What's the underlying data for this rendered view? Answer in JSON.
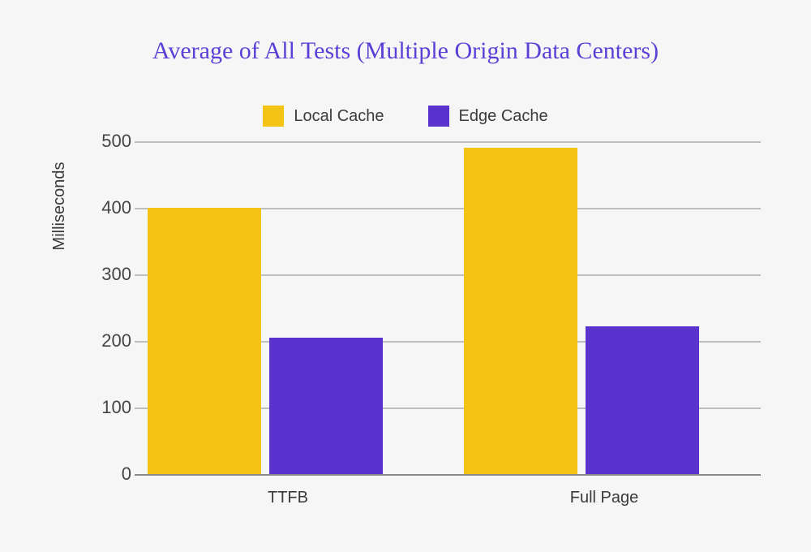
{
  "title": "Average of All Tests (Multiple Origin Data Centers)",
  "legend": {
    "local": "Local Cache",
    "edge": "Edge Cache"
  },
  "ylabel": "Milliseconds",
  "yticks": {
    "t0": "0",
    "t100": "100",
    "t200": "200",
    "t300": "300",
    "t400": "400",
    "t500": "500"
  },
  "categories": {
    "c0": "TTFB",
    "c1": "Full Page"
  },
  "colors": {
    "local": "#f4c414",
    "edge": "#5a33cf"
  },
  "chart_data": {
    "type": "bar",
    "title": "Average of All Tests (Multiple Origin Data Centers)",
    "xlabel": "",
    "ylabel": "Milliseconds",
    "ylim": [
      0,
      500
    ],
    "categories": [
      "TTFB",
      "Full Page"
    ],
    "series": [
      {
        "name": "Local Cache",
        "values": [
          400,
          490
        ]
      },
      {
        "name": "Edge Cache",
        "values": [
          205,
          222
        ]
      }
    ],
    "legend_position": "top",
    "grid": true
  }
}
